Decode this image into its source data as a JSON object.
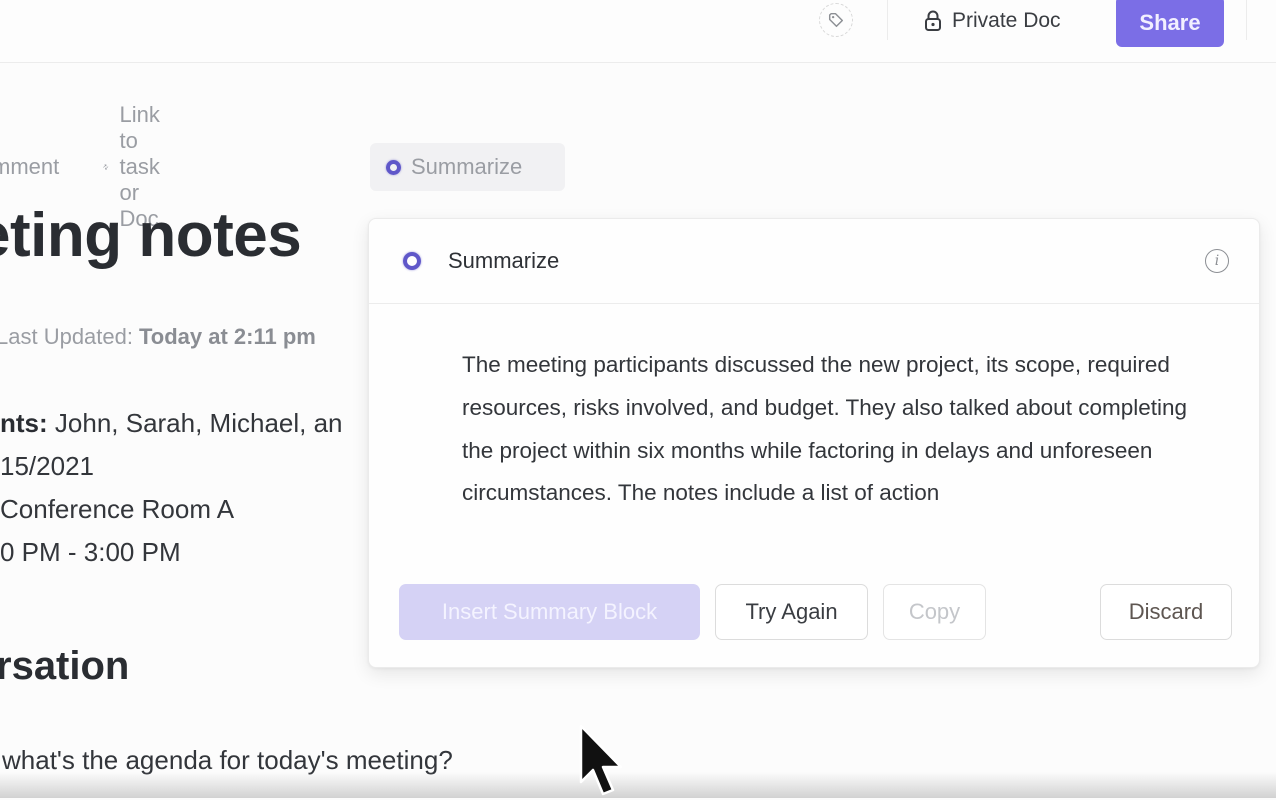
{
  "topbar": {
    "tag_icon": "tag-icon",
    "lock_icon": "lock-icon",
    "private_doc_label": "Private Doc",
    "share_label": "Share",
    "accent_color": "#7b6ee6"
  },
  "doc_toolbar": {
    "comment_label": "mment",
    "link_icon": "link-arrows-icon",
    "link_label": "Link to task or Doc",
    "summarize_icon": "ai-ring-icon",
    "summarize_label": "Summarize"
  },
  "document": {
    "title": "eting notes",
    "last_updated_label": "Last Updated:",
    "last_updated_value": "Today at 2:11 pm",
    "participants_label": "nts:",
    "participants_value": " John, Sarah, Michael, an",
    "date_value": "15/2021",
    "location_value": " Conference Room A",
    "time_value": "0 PM - 3:00 PM",
    "section_heading": "rsation",
    "agenda_line": "what's the agenda for today's meeting?"
  },
  "summarize_popup": {
    "title": "Summarize",
    "title_icon": "ai-ring-icon",
    "info_icon": "info-icon",
    "summary_text": "The meeting participants discussed the new project, its scope, required resources, risks involved, and budget. They also talked about completing the project within six months while factoring in delays and unforeseen circumstances. The notes include a list of action",
    "buttons": {
      "insert": "Insert Summary Block",
      "try_again": "Try Again",
      "copy": "Copy",
      "discard": "Discard"
    }
  }
}
